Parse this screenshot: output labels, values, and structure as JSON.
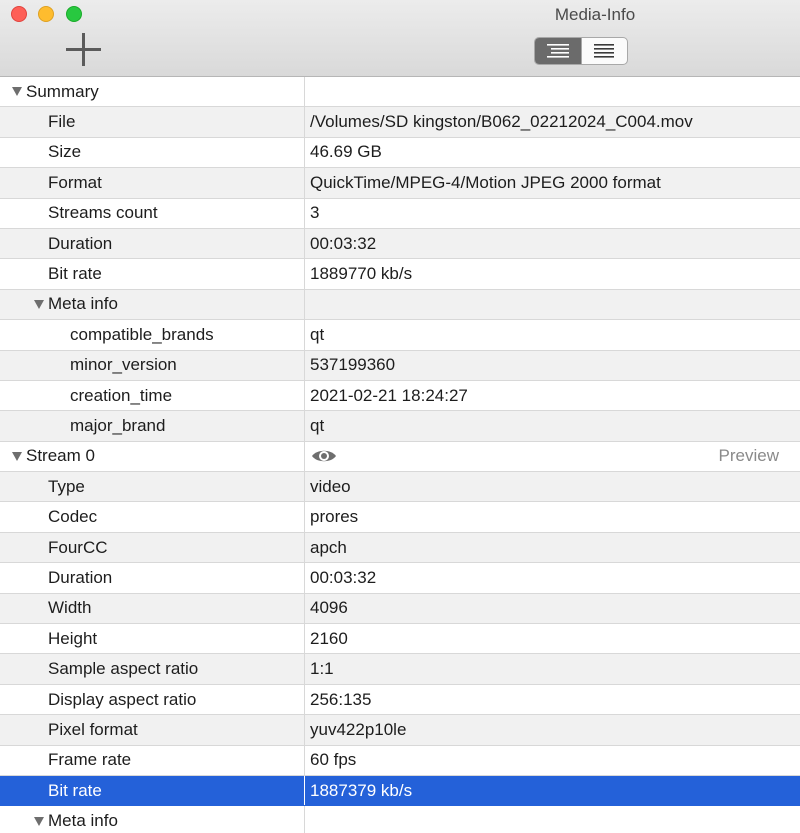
{
  "window": {
    "title": "Media-Info",
    "add_button_icon": "plus-icon",
    "view_modes": [
      {
        "name": "outline-view",
        "icon": "indented-list-icon",
        "active": true
      },
      {
        "name": "flat-view",
        "icon": "list-icon",
        "active": false
      }
    ]
  },
  "rows": [
    {
      "kind": "group",
      "level": 0,
      "label": "Summary",
      "value": ""
    },
    {
      "kind": "field",
      "level": 1,
      "label": "File",
      "value": "/Volumes/SD kingston/B062_02212024_C004.mov"
    },
    {
      "kind": "field",
      "level": 1,
      "label": "Size",
      "value": "46.69 GB"
    },
    {
      "kind": "field",
      "level": 1,
      "label": "Format",
      "value": "QuickTime/MPEG-4/Motion JPEG 2000 format"
    },
    {
      "kind": "field",
      "level": 1,
      "label": "Streams count",
      "value": "3"
    },
    {
      "kind": "field",
      "level": 1,
      "label": "Duration",
      "value": "00:03:32"
    },
    {
      "kind": "field",
      "level": 1,
      "label": "Bit rate",
      "value": "1889770 kb/s"
    },
    {
      "kind": "group",
      "level": 1,
      "label": "Meta info",
      "value": ""
    },
    {
      "kind": "field",
      "level": 2,
      "label": "compatible_brands",
      "value": "qt"
    },
    {
      "kind": "field",
      "level": 2,
      "label": "minor_version",
      "value": "537199360"
    },
    {
      "kind": "field",
      "level": 2,
      "label": "creation_time",
      "value": "2021-02-21 18:24:27"
    },
    {
      "kind": "field",
      "level": 2,
      "label": "major_brand",
      "value": "qt"
    },
    {
      "kind": "stream",
      "level": 0,
      "label": "Stream 0",
      "value": "",
      "preview": "Preview"
    },
    {
      "kind": "field",
      "level": 1,
      "label": "Type",
      "value": "video"
    },
    {
      "kind": "field",
      "level": 1,
      "label": "Codec",
      "value": "prores"
    },
    {
      "kind": "field",
      "level": 1,
      "label": "FourCC",
      "value": "apch"
    },
    {
      "kind": "field",
      "level": 1,
      "label": "Duration",
      "value": "00:03:32"
    },
    {
      "kind": "field",
      "level": 1,
      "label": "Width",
      "value": "4096"
    },
    {
      "kind": "field",
      "level": 1,
      "label": "Height",
      "value": "2160"
    },
    {
      "kind": "field",
      "level": 1,
      "label": "Sample aspect ratio",
      "value": "1:1"
    },
    {
      "kind": "field",
      "level": 1,
      "label": "Display aspect ratio",
      "value": "256:135"
    },
    {
      "kind": "field",
      "level": 1,
      "label": "Pixel format",
      "value": "yuv422p10le"
    },
    {
      "kind": "field",
      "level": 1,
      "label": "Frame rate",
      "value": "60 fps"
    },
    {
      "kind": "field",
      "level": 1,
      "label": "Bit rate",
      "value": "1887379 kb/s",
      "selected": true
    },
    {
      "kind": "group",
      "level": 1,
      "label": "Meta info",
      "value": ""
    }
  ],
  "colors": {
    "selection": "#2461d9",
    "row_alt": "#f1f1f1",
    "close": "#fe5f57",
    "minimize": "#febc2e",
    "zoom": "#28c840"
  }
}
